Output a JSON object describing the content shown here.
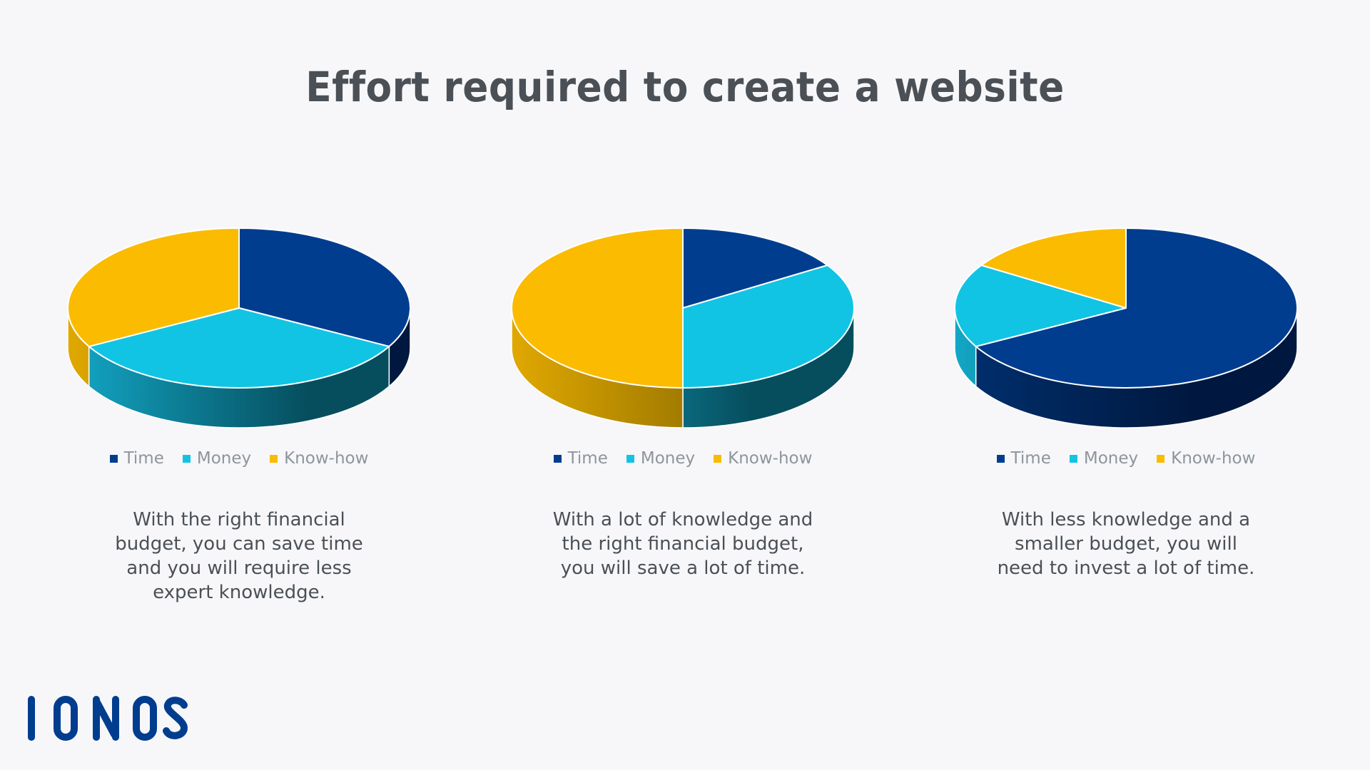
{
  "title": "Effort required to create a website",
  "colors": {
    "time": "#003d8f",
    "money": "#12c4e3",
    "knowhow": "#fbbb00",
    "background": "#f7f7f9",
    "text": "#4b5056",
    "legend_text": "#8e959c",
    "logo": "#003d8f"
  },
  "logo": {
    "text": "IONOS"
  },
  "legend": [
    "Time",
    "Money",
    "Know-how"
  ],
  "chart_data": [
    {
      "type": "pie",
      "style": "3d",
      "categories": [
        "Time",
        "Money",
        "Know-how"
      ],
      "values": [
        33,
        34,
        33
      ],
      "legend_placement": "bottom",
      "caption_lines": [
        "With the right financial",
        "budget, you can save time",
        "and you will require less",
        "expert knowledge."
      ]
    },
    {
      "type": "pie",
      "style": "3d",
      "categories": [
        "Time",
        "Money",
        "Know-how"
      ],
      "values": [
        16,
        34,
        50
      ],
      "legend_placement": "bottom",
      "caption_lines": [
        "With a lot of knowledge and",
        "the right financial budget,",
        "you will save a lot of time."
      ]
    },
    {
      "type": "pie",
      "style": "3d",
      "categories": [
        "Time",
        "Money",
        "Know-how"
      ],
      "values": [
        67,
        17,
        16
      ],
      "legend_placement": "bottom",
      "caption_lines": [
        "With less knowledge and a",
        "smaller budget, you will",
        "need to invest a lot of time."
      ]
    }
  ]
}
